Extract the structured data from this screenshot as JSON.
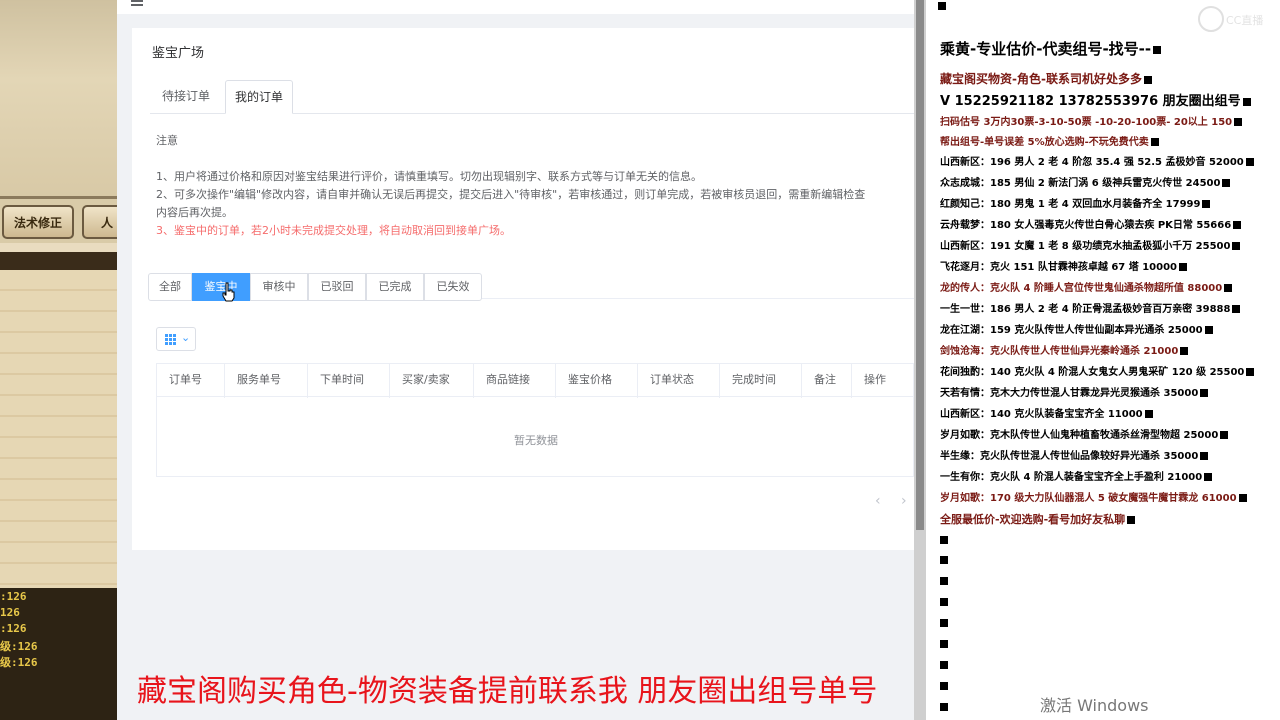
{
  "game": {
    "tab_1": "法术修正",
    "tab_2": "人",
    "stats": [
      ":126",
      "126",
      ":126",
      "级:126",
      "级:126"
    ]
  },
  "page": {
    "title": "鉴宝广场",
    "tabs": [
      "待接订单",
      "我的订单"
    ],
    "notice": {
      "title": "注意",
      "line_1": "1、用户将通过价格和原因对鉴宝结果进行评价，请慎重填写。切勿出现辑别字、联系方式等与订单无关的信息。",
      "line_2": "2、可多次操作\"编辑\"修改内容，请自审并确认无误后再提交，提交后进入\"待审核\"，若审核通过，则订单完成，若被审核员退回，需重新编辑检查",
      "line_2b": "内容后再次提。",
      "line_3": "3、鉴宝中的订单，若2小时未完成提交处理，将自动取消回到接单广场。"
    },
    "status_filters": [
      "全部",
      "鉴宝中",
      "审核中",
      "已驳回",
      "已完成",
      "已失效"
    ],
    "table": {
      "columns": [
        "订单号",
        "服务单号",
        "下单时间",
        "买家/卖家",
        "商品链接",
        "鉴宝价格",
        "订单状态",
        "完成时间",
        "备注",
        "操作"
      ],
      "empty": "暂无数据"
    }
  },
  "right": {
    "header": "乘黄-专业估价-代卖组号-找号--",
    "lines": [
      {
        "text": "藏宝阁买物资-角色-联系司机好处多多",
        "color": "#7a1a14",
        "size": 12
      },
      {
        "text": "V 15225921182   13782553976 朋友圈出组号",
        "color": "#000000",
        "size": 13
      },
      {
        "text": "扫码估号 3万内30票-3-10-50票 -10-20-100票- 20以上 150",
        "color": "#7a1a14",
        "size": 10
      },
      {
        "text": "帮出组号-单号误差 5%放心选购-不玩免费代卖",
        "color": "#7a1a14",
        "size": 10
      },
      {
        "text": "山西新区：196 男人 2 老 4 阶忽 35.4 强 52.5 孟极妙音 52000",
        "color": "#000000",
        "size": 10
      },
      {
        "text": "众志成城：185 男仙 2 新法门涡 6 级神兵雷克火传世 24500",
        "color": "#000000",
        "size": 10
      },
      {
        "text": "红颜知己：180 男鬼 1 老 4 双回血水月装备齐全 17999",
        "color": "#000000",
        "size": 10
      },
      {
        "text": "云舟载梦：180 女人强毒克火传世白骨心猿去疾 PK日常 55666",
        "color": "#000000",
        "size": 10
      },
      {
        "text": "山西新区：191 女魔 1 老 8 级功绩克水抽孟极狐小千万 25500",
        "color": "#000000",
        "size": 10
      },
      {
        "text": "飞花逐月：克火 151 队甘霖神孩卓越 67 塔 10000",
        "color": "#000000",
        "size": 10
      },
      {
        "text": "龙的传人：克火队 4 阶睡人宫位传世鬼仙通杀物超所值 88000",
        "color": "#7a1a14",
        "size": 10
      },
      {
        "text": "一生一世：186 男人 2 老 4 阶正骨混孟极妙音百万亲密 39888",
        "color": "#000000",
        "size": 10
      },
      {
        "text": "龙在江湖：159 克火队传世人传世仙副本异光通杀 25000",
        "color": "#000000",
        "size": 10
      },
      {
        "text": "剑蚀沧海：克火队传世人传世仙异光秦岭通杀 21000",
        "color": "#7a1a14",
        "size": 10
      },
      {
        "text": "花间独酌：140 克火队 4 阶混人女鬼女人男鬼采矿 120 级 25500",
        "color": "#000000",
        "size": 10
      },
      {
        "text": "天若有情：克木大力传世混人甘霖龙异光灵猴通杀 35000",
        "color": "#000000",
        "size": 10
      },
      {
        "text": "山西新区：140 克火队装备宝宝齐全 11000",
        "color": "#000000",
        "size": 10
      },
      {
        "text": "岁月如歌：克木队传世人仙鬼种植畜牧通杀丝滑型物超 25000",
        "color": "#000000",
        "size": 10
      },
      {
        "text": "半生缘：克火队传世混人传世仙品像较好异光通杀 35000",
        "color": "#000000",
        "size": 10
      },
      {
        "text": "一生有你：克火队 4 阶混人装备宝宝齐全上手盈利 21000",
        "color": "#000000",
        "size": 10
      },
      {
        "text": "岁月如歌：170 级大力队仙器混人 5 破女魔强牛魔甘霖龙 61000",
        "color": "#7a1a14",
        "size": 10
      },
      {
        "text": "全服最低价-欢迎选购-看号加好友私聊",
        "color": "#7a1a14",
        "size": 11
      }
    ],
    "watermark": "CC直播"
  },
  "overlay": {
    "caption": "藏宝阁购买角色-物资装备提前联系我     朋友圈出组号单号",
    "activate": "激活 Windows"
  }
}
